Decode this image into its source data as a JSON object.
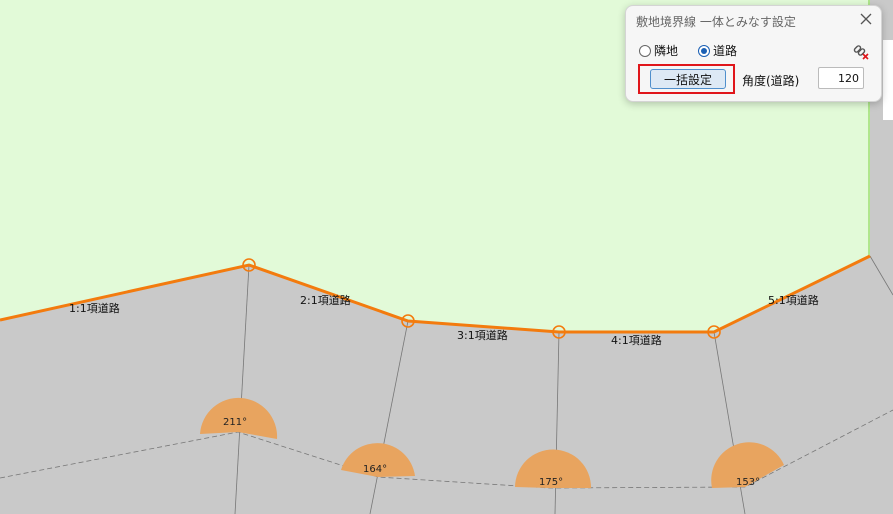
{
  "dialog": {
    "title": "敷地境界線 一体とみなす設定",
    "radio_neighbor": "隣地",
    "radio_road": "道路",
    "selected": "道路",
    "bulk_button": "一括設定",
    "angle_label": "角度(道路)",
    "angle_value": "120"
  },
  "canvas": {
    "colors": {
      "site": "#e2fad8",
      "road": "#c9c9c9",
      "boundary": "#f37b0e",
      "arc": "#e8a45f"
    },
    "segments": [
      {
        "label": "1:1項道路"
      },
      {
        "label": "2:1項道路"
      },
      {
        "label": "3:1項道路"
      },
      {
        "label": "4:1項道路"
      },
      {
        "label": "5:1項道路"
      }
    ],
    "angles": [
      "211°",
      "164°",
      "175°",
      "153°"
    ]
  }
}
